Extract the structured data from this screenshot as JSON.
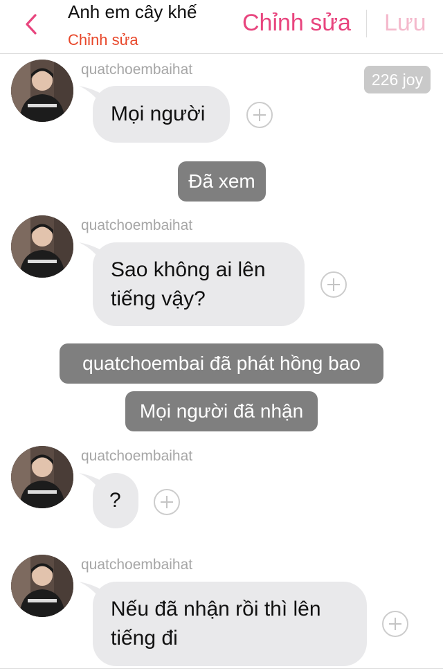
{
  "header": {
    "title": "Anh em cây khế",
    "subtitle": "Chỉnh sửa",
    "edit_label": "Chỉnh sửa",
    "save_label": "Lưu"
  },
  "joy_badge": "226 joy",
  "messages": [
    {
      "sender": "quatchoembaihat",
      "lines": [
        "Mọi người"
      ]
    },
    {
      "sender": "quatchoembaihat",
      "lines": [
        "Sao không ai lên",
        "tiếng vậy?"
      ]
    },
    {
      "sender": "quatchoembaihat",
      "lines": [
        "?"
      ]
    },
    {
      "sender": "quatchoembaihat",
      "lines": [
        "Nếu đã nhận rồi thì lên",
        "tiếng đi"
      ]
    }
  ],
  "system_notices": [
    "Đã xem",
    "quatchoembai đã phát hồng bao",
    "Mọi người đã nhận"
  ],
  "colors": {
    "accent_pink": "#e8457e",
    "save_disabled": "#f4b9cc",
    "subtitle_red": "#e8472a",
    "bubble_gray": "#e9e9eb",
    "system_gray": "#7f7f7f"
  },
  "icons": {
    "back": "chevron-left-icon",
    "react": "plus-circle-icon"
  }
}
